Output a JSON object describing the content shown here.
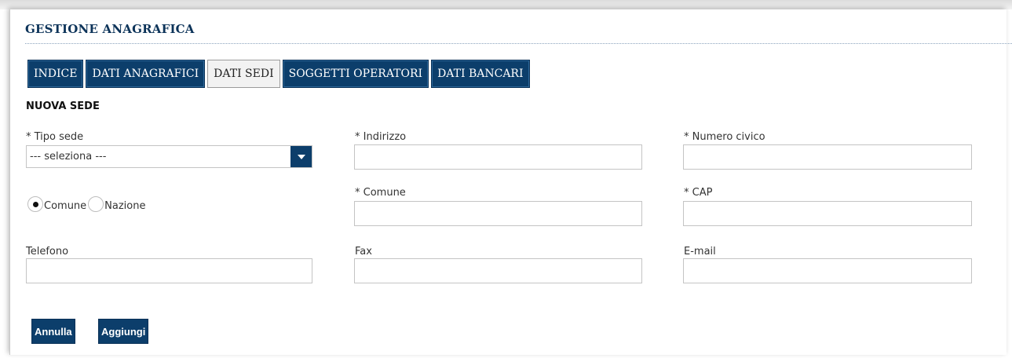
{
  "page_title": "GESTIONE ANAGRAFICA",
  "tabs": [
    {
      "label": "INDICE",
      "active": false
    },
    {
      "label": "DATI ANAGRAFICI",
      "active": false
    },
    {
      "label": "DATI SEDI",
      "active": true
    },
    {
      "label": "SOGGETTI OPERATORI",
      "active": false
    },
    {
      "label": "DATI BANCARI",
      "active": false
    }
  ],
  "section_title": "NUOVA SEDE",
  "fields": {
    "tipo_sede": {
      "label": "* Tipo sede",
      "value": "--- seleziona ---"
    },
    "indirizzo": {
      "label": "* Indirizzo",
      "value": ""
    },
    "numero_civico": {
      "label": "* Numero civico",
      "value": ""
    },
    "comune": {
      "label": "* Comune",
      "value": ""
    },
    "cap": {
      "label": "* CAP",
      "value": ""
    },
    "telefono": {
      "label": "Telefono",
      "value": ""
    },
    "fax": {
      "label": "Fax",
      "value": ""
    },
    "email": {
      "label": "E-mail",
      "value": ""
    }
  },
  "location_type": {
    "options": [
      "Comune",
      "Nazione"
    ],
    "selected": "Comune"
  },
  "buttons": {
    "cancel": "Annulla",
    "add": "Aggiungi"
  },
  "colors": {
    "primary": "#0c3e6b",
    "title": "#0c3359"
  }
}
